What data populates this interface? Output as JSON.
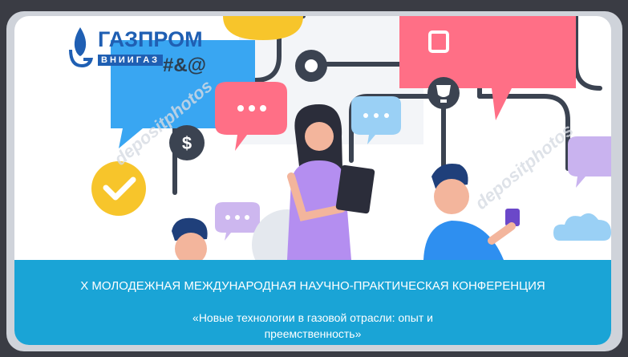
{
  "logo": {
    "name": "ГАЗПРОМ",
    "sub": "ВНИИГАЗ"
  },
  "symbols": "#&@",
  "watermark": "depositphotos",
  "banner": {
    "title": "X МОЛОДЕЖНАЯ МЕЖДУНАРОДНАЯ НАУЧНО-ПРАКТИЧЕСКАЯ КОНФЕРЕНЦИЯ",
    "subtitle": "«Новые технологии в газовой отрасли: опыт и преемственность»"
  },
  "icons": [
    "gear-icon",
    "dollar-icon",
    "trophy-icon",
    "check-icon",
    "cup-icon",
    "cloud-icon",
    "speech-bubble-icon"
  ],
  "colors": {
    "banner": "#1aa4d6",
    "logo": "#1f5fb3",
    "bubble_pink": "#ff6f86",
    "bubble_blue": "#39a6f2",
    "check_yellow": "#f7c52b"
  }
}
